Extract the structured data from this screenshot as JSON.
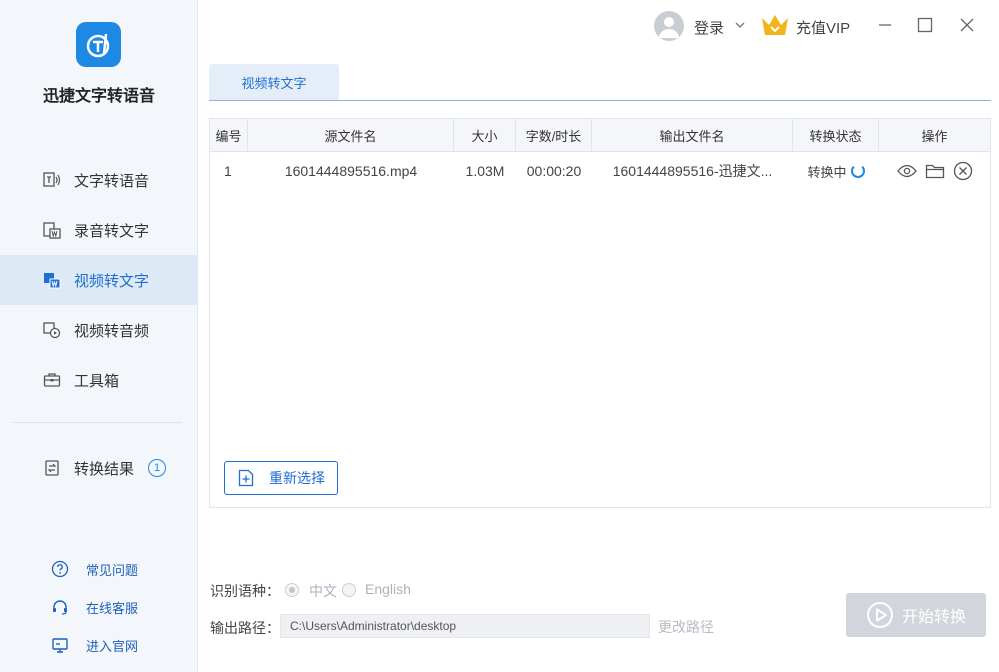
{
  "app": {
    "title": "迅捷文字转语音",
    "logo_letter": "T"
  },
  "sidebar": {
    "items": [
      {
        "label": "文字转语音",
        "icon": "text-to-speech-icon",
        "active": false
      },
      {
        "label": "录音转文字",
        "icon": "audio-to-text-icon",
        "active": false
      },
      {
        "label": "视频转文字",
        "icon": "video-to-text-icon",
        "active": true
      },
      {
        "label": "视频转音频",
        "icon": "video-to-audio-icon",
        "active": false
      },
      {
        "label": "工具箱",
        "icon": "toolbox-icon",
        "active": false
      }
    ],
    "result": {
      "label": "转换结果",
      "count": "1"
    },
    "help": [
      {
        "label": "常见问题",
        "icon": "question-icon"
      },
      {
        "label": "在线客服",
        "icon": "headset-icon"
      },
      {
        "label": "进入官网",
        "icon": "monitor-icon"
      }
    ]
  },
  "topbar": {
    "login_label": "登录",
    "vip_label": "充值VIP"
  },
  "tab": {
    "label": "视频转文字"
  },
  "table": {
    "headers": [
      "编号",
      "源文件名",
      "大小",
      "字数/时长",
      "输出文件名",
      "转换状态",
      "操作"
    ],
    "rows": [
      {
        "index": "1",
        "source": "1601444895516.mp4",
        "size": "1.03M",
        "duration": "00:00:20",
        "output": "1601444895516-迅捷文...",
        "status": "转换中"
      }
    ]
  },
  "reselect_label": "重新选择",
  "settings": {
    "lang_label": "识别语种：",
    "lang_options": [
      "中文",
      "English"
    ],
    "selected_lang": "中文",
    "path_label": "输出路径：",
    "path_value": "C:\\Users\\Administrator\\desktop",
    "change_path_label": "更改路径",
    "start_label": "开始转换"
  },
  "colors": {
    "accent": "#1e88e5",
    "sidebar_bg": "#f3f7fb",
    "active_bg": "#dde9f5",
    "disabled_btn": "#d2d6dc",
    "vip_gold": "#f5b31b"
  }
}
